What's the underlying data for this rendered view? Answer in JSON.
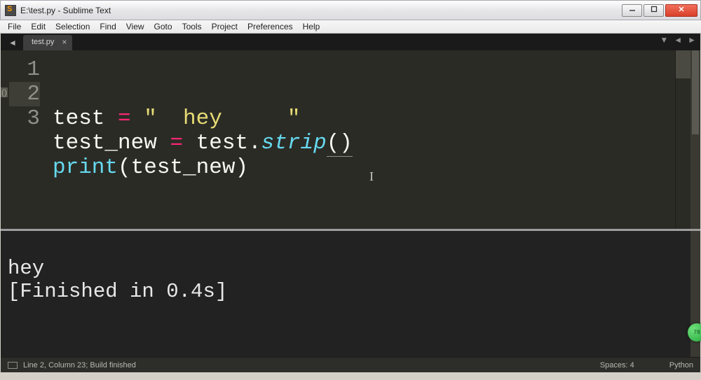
{
  "window": {
    "title": "E:\\test.py - Sublime Text"
  },
  "menu": {
    "items": [
      "File",
      "Edit",
      "Selection",
      "Find",
      "View",
      "Goto",
      "Tools",
      "Project",
      "Preferences",
      "Help"
    ]
  },
  "tabs": {
    "active": {
      "label": "test.py",
      "close_glyph": "×"
    },
    "left_arrow": "◄",
    "right_dropdown": "▼",
    "right_left_arrow": "◄",
    "right_right_arrow": "►"
  },
  "gutter": {
    "brace_hint": "()"
  },
  "code": {
    "lines": [
      {
        "n": "1",
        "tokens": [
          {
            "t": "test ",
            "c": "tok-id"
          },
          {
            "t": "=",
            "c": "tok-op"
          },
          {
            "t": " ",
            "c": "tok-id"
          },
          {
            "t": "\"  hey     \"",
            "c": "tok-str"
          }
        ]
      },
      {
        "n": "2",
        "current": true,
        "tokens": [
          {
            "t": "test_new ",
            "c": "tok-id"
          },
          {
            "t": "=",
            "c": "tok-op"
          },
          {
            "t": " test",
            "c": "tok-id"
          },
          {
            "t": ".",
            "c": "tok-punc"
          },
          {
            "t": "strip",
            "c": "tok-fn"
          },
          {
            "t": "()",
            "c": "tok-punc tok-und"
          }
        ]
      },
      {
        "n": "3",
        "tokens": [
          {
            "t": "print",
            "c": "tok-call"
          },
          {
            "t": "(test_new)",
            "c": "tok-punc"
          }
        ]
      }
    ]
  },
  "console": {
    "line1": "hey",
    "line2": "[Finished in 0.4s]"
  },
  "badge": {
    "text": "78"
  },
  "status": {
    "left": "Line 2, Column 23; Build finished",
    "spaces": "Spaces: 4",
    "lang": "Python"
  }
}
